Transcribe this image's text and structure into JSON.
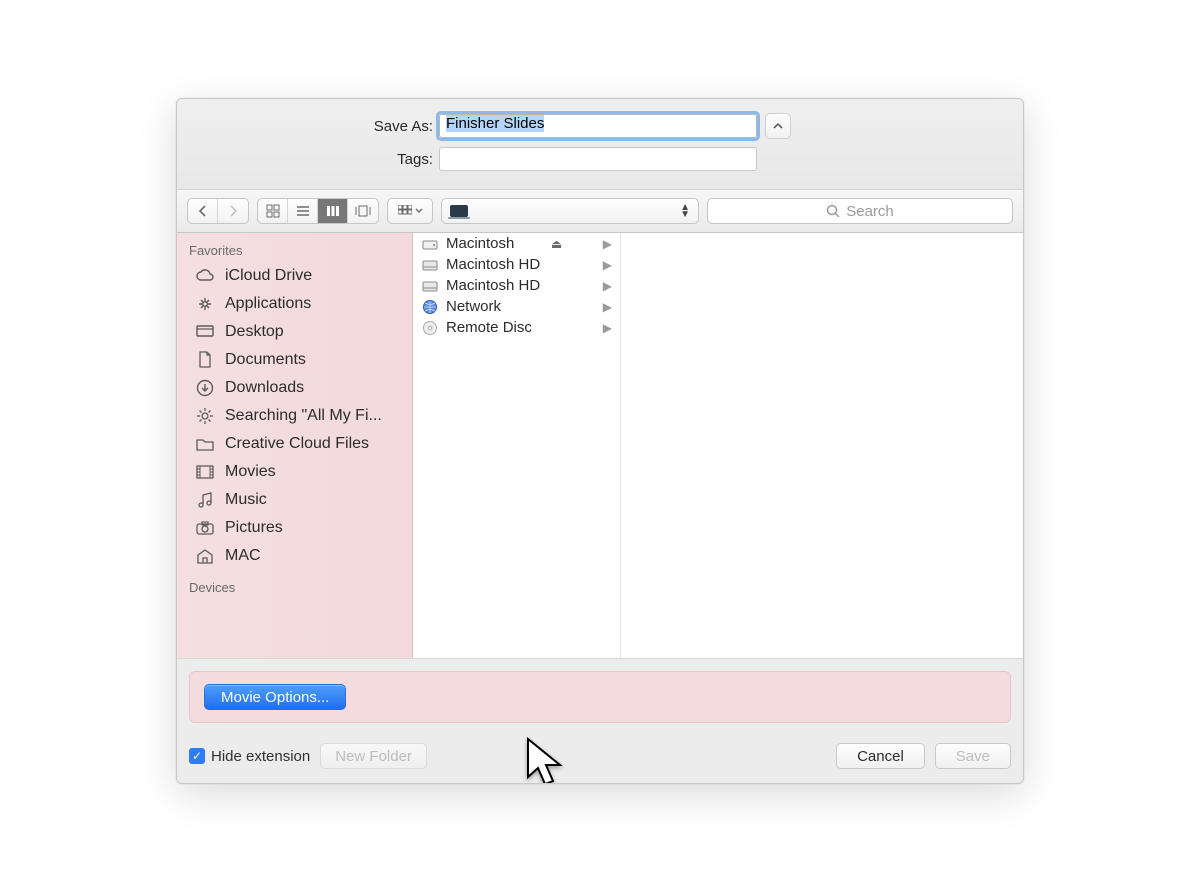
{
  "header": {
    "saveas_label": "Save As:",
    "saveas_value": "Finisher Slides",
    "tags_label": "Tags:",
    "tags_value": ""
  },
  "toolbar": {
    "search_placeholder": "Search",
    "path_label": ""
  },
  "sidebar": {
    "favorites_title": "Favorites",
    "items": [
      {
        "label": "iCloud Drive"
      },
      {
        "label": "Applications"
      },
      {
        "label": "Desktop"
      },
      {
        "label": "Documents"
      },
      {
        "label": "Downloads"
      },
      {
        "label": "Searching \"All My Fi..."
      },
      {
        "label": "Creative Cloud Files"
      },
      {
        "label": "Movies"
      },
      {
        "label": "Music"
      },
      {
        "label": "Pictures"
      },
      {
        "label": "MAC"
      }
    ],
    "devices_title": "Devices"
  },
  "column": {
    "rows": [
      {
        "label": "Macintosh",
        "eject": true,
        "arrow": true,
        "kind": "drive"
      },
      {
        "label": "Macintosh HD",
        "eject": false,
        "arrow": true,
        "kind": "hd"
      },
      {
        "label": "Macintosh HD",
        "eject": false,
        "arrow": true,
        "kind": "hd"
      },
      {
        "label": "Network",
        "eject": false,
        "arrow": true,
        "kind": "network"
      },
      {
        "label": "Remote Disc",
        "eject": false,
        "arrow": true,
        "kind": "disc"
      }
    ]
  },
  "options": {
    "movie_options_label": "Movie Options..."
  },
  "bottom": {
    "hide_ext_label": "Hide extension",
    "new_folder_label": "New Folder",
    "cancel_label": "Cancel",
    "save_label": "Save"
  }
}
